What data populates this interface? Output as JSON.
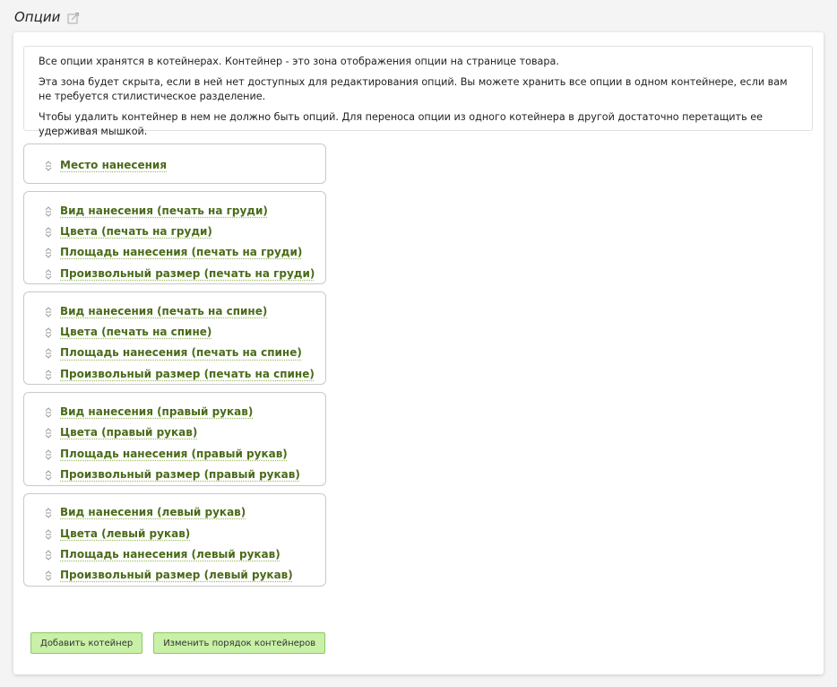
{
  "header": {
    "title": "Опции"
  },
  "info": {
    "line1": "Все опции хранятся в котейнерах. Контейнер - это зона отображения опции на странице товара.",
    "line2": "Эта зона будет скрыта, если в ней нет доступных для редактирования опций. Вы можете хранить все опции в одном контейнере, если вам не требуется стилистическое разделение.",
    "line3": "Чтобы удалить контейнер в нем не должно быть опций. Для переноса опции из одного котейнера в другой достаточно перетащить ее удерживая мышкой."
  },
  "containers": [
    {
      "options": [
        "Место нанесения"
      ]
    },
    {
      "options": [
        "Вид нанесения (печать на груди)",
        "Цвета (печать на груди)",
        "Площадь нанесения (печать на груди)",
        "Произвольный размер (печать на груди)"
      ]
    },
    {
      "options": [
        "Вид нанесения (печать на спине)",
        "Цвета (печать на спине)",
        "Площадь нанесения (печать на спине)",
        "Произвольный размер (печать на спине)"
      ]
    },
    {
      "options": [
        "Вид нанесения (правый рукав)",
        "Цвета (правый рукав)",
        "Площадь нанесения (правый рукав)",
        "Произвольный размер (правый рукав)"
      ]
    },
    {
      "options": [
        "Вид нанесения (левый рукав)",
        "Цвета (левый рукав)",
        "Площадь нанесения (левый рукав)",
        "Произвольный размер (левый рукав)"
      ]
    }
  ],
  "buttons": {
    "add_container": "Добавить котейнер",
    "reorder_containers": "Изменить порядок контейнеров"
  },
  "colors": {
    "option_link": "#4a6b1a",
    "button_bg": "#c8f0a6",
    "button_border": "#8fc868"
  },
  "icons": {
    "title_action": "edit-icon",
    "option_handle": "drag-handle-icon"
  }
}
